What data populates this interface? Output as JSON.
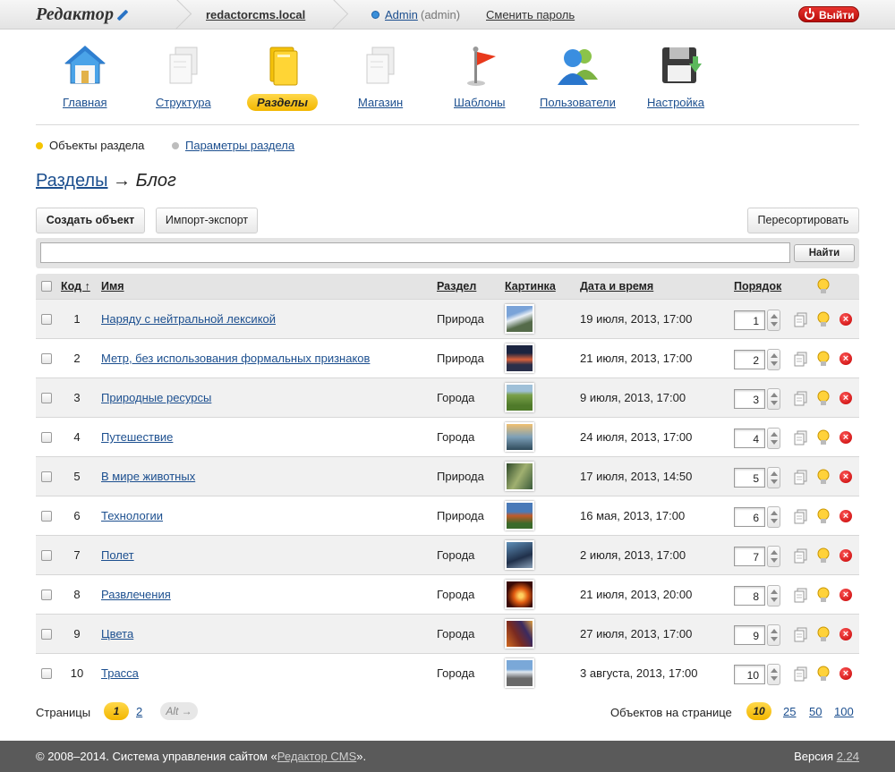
{
  "header": {
    "logo": "Редактор",
    "site": "redactorcms.local",
    "user": "Admin",
    "role": "(admin)",
    "change_password": "Сменить пароль",
    "logout": "Выйти"
  },
  "nav": {
    "items": [
      {
        "label": "Главная",
        "icon": "home-icon"
      },
      {
        "label": "Структура",
        "icon": "documents-icon"
      },
      {
        "label": "Разделы",
        "icon": "folder-icon",
        "active": true
      },
      {
        "label": "Магазин",
        "icon": "documents-icon"
      },
      {
        "label": "Шаблоны",
        "icon": "flag-icon"
      },
      {
        "label": "Пользователи",
        "icon": "users-icon"
      },
      {
        "label": "Настройка",
        "icon": "floppy-disk-icon"
      }
    ]
  },
  "subnav": {
    "objects": "Объекты раздела",
    "params": "Параметры раздела"
  },
  "heading": {
    "section": "Разделы",
    "arrow": "→",
    "current": "Блог"
  },
  "toolbar": {
    "create": "Создать объект",
    "import": "Импорт-экспорт",
    "resort": "Пересортировать"
  },
  "search": {
    "value": "",
    "button": "Найти"
  },
  "table": {
    "columns": {
      "code": "Код ↑",
      "name": "Имя",
      "section": "Раздел",
      "picture": "Картинка",
      "datetime": "Дата и время",
      "order": "Порядок"
    },
    "rows": [
      {
        "code": "1",
        "name": "Наряду с нейтральной лексикой",
        "section": "Природа",
        "date": "19 июля, 2013, 17:00",
        "order": "1"
      },
      {
        "code": "2",
        "name": "Метр, без использования формальных признаков",
        "section": "Природа",
        "date": "21 июля, 2013, 17:00",
        "order": "2"
      },
      {
        "code": "3",
        "name": "Природные ресурсы",
        "section": "Города",
        "date": "9 июля, 2013, 17:00",
        "order": "3"
      },
      {
        "code": "4",
        "name": "Путешествие",
        "section": "Города",
        "date": "24 июля, 2013, 17:00",
        "order": "4"
      },
      {
        "code": "5",
        "name": "В мире животных",
        "section": "Природа",
        "date": "17 июля, 2013, 14:50",
        "order": "5"
      },
      {
        "code": "6",
        "name": "Технологии",
        "section": "Природа",
        "date": "16 мая, 2013, 17:00",
        "order": "6"
      },
      {
        "code": "7",
        "name": "Полет",
        "section": "Города",
        "date": "2 июля, 2013, 17:00",
        "order": "7"
      },
      {
        "code": "8",
        "name": "Развлечения",
        "section": "Города",
        "date": "21 июля, 2013, 20:00",
        "order": "8"
      },
      {
        "code": "9",
        "name": "Цвета",
        "section": "Города",
        "date": "27 июля, 2013, 17:00",
        "order": "9"
      },
      {
        "code": "10",
        "name": "Трасса",
        "section": "Города",
        "date": "3 августа, 2013, 17:00",
        "order": "10"
      }
    ]
  },
  "pagination": {
    "label": "Страницы",
    "current": "1",
    "page2": "2",
    "next": "Alt →",
    "per_page_label": "Объектов на странице",
    "per_page_current": "10",
    "per_page_options": [
      "25",
      "50",
      "100"
    ]
  },
  "footer": {
    "copyright_prefix": "© 2008–2014. Система управления сайтом «",
    "cms_link": "Редактор CMS",
    "copyright_suffix": "».",
    "version_label": "Версия",
    "version": "2.24"
  },
  "colors": {
    "accent_yellow": "#f2b600",
    "link_blue": "#1c4f8f",
    "logout_red": "#d3201c",
    "footer_bg": "#5a5a5a"
  }
}
